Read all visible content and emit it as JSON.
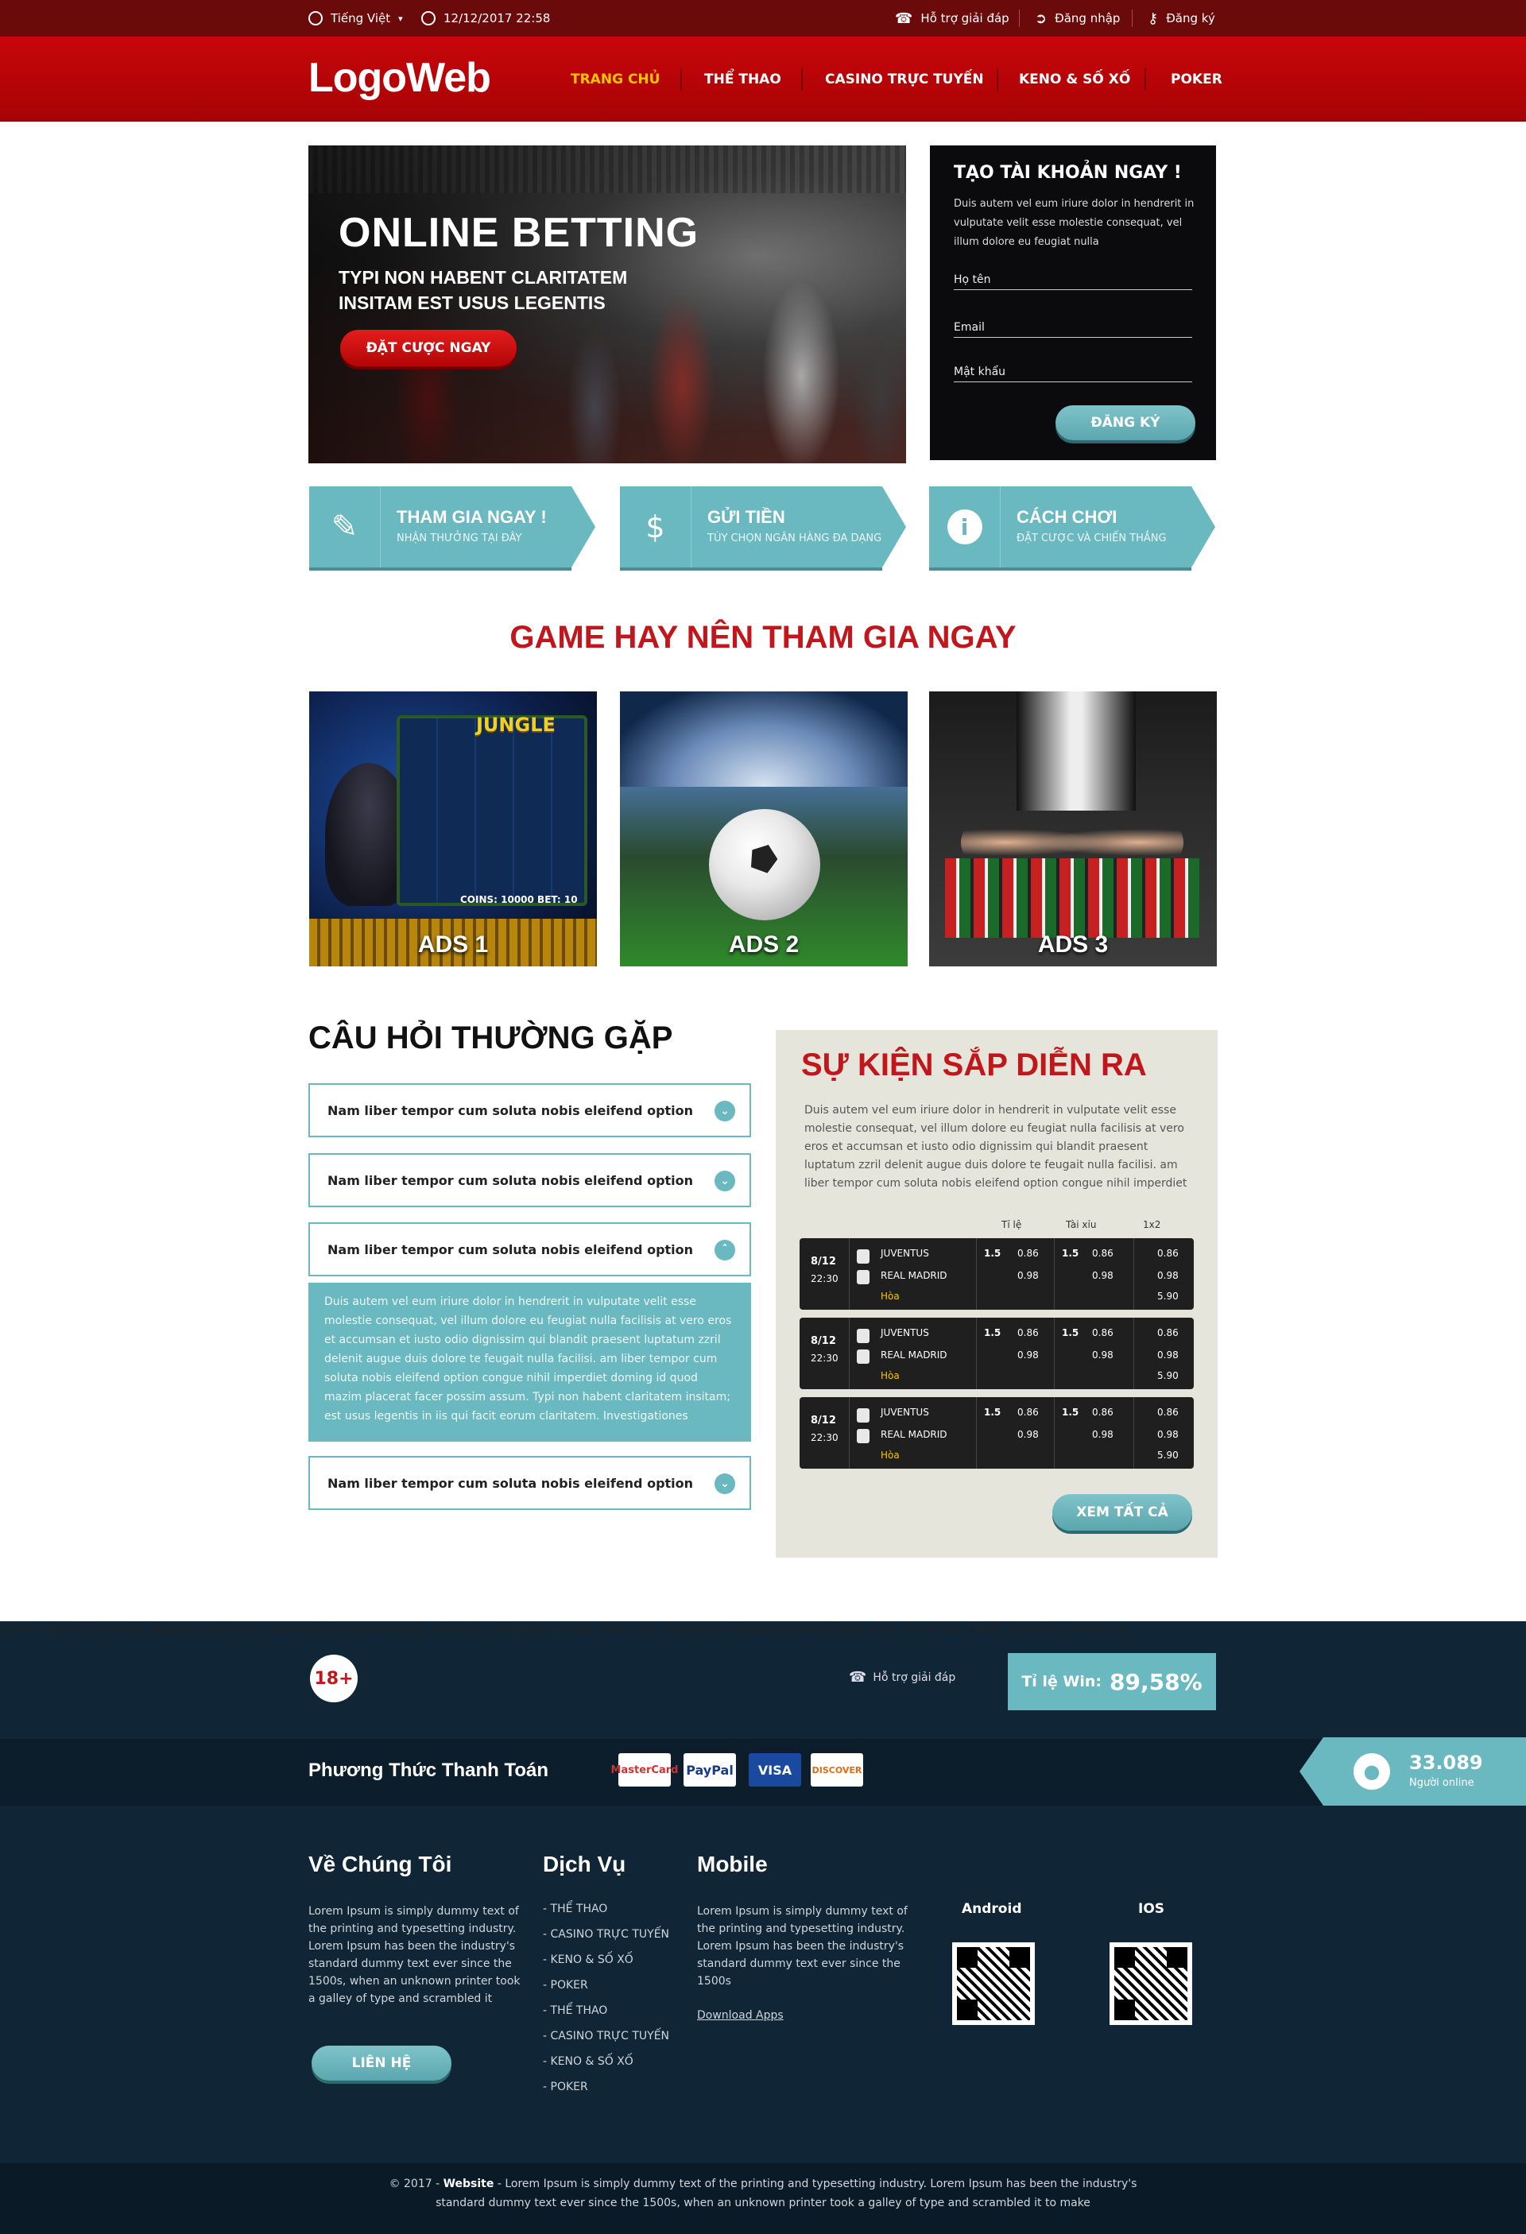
{
  "topbar": {
    "language": "Tiếng Việt",
    "datetime": "12/12/2017 22:58",
    "support": "Hỗ trợ giải đáp",
    "login": "Đăng nhập",
    "register": "Đăng ký"
  },
  "header": {
    "logo": "LogoWeb",
    "nav": [
      "TRANG CHỦ",
      "THỂ THAO",
      "CASINO TRỰC TUYẾN",
      "KENO & SỐ XỐ",
      "POKER"
    ]
  },
  "hero": {
    "title": "ONLINE BETTING",
    "subtitle": "TYPI NON HABENT CLARITATEM INSITAM EST USUS LEGENTIS",
    "cta": "ĐẶT CƯỢC NGAY"
  },
  "signup": {
    "title": "TẠO TÀI KHOẢN NGAY !",
    "desc": "Duis autem vel eum iriure dolor in hendrerit in vulputate velit esse molestie consequat, vel illum dolore eu feugiat nulla",
    "name_label": "Họ tên",
    "email_label": "Email",
    "password_label": "Mật khẩu",
    "submit": "ĐĂNG KÝ"
  },
  "features": [
    {
      "title": "THAM GIA NGAY !",
      "sub": "NHẬN THƯỞNG TẠI ĐÂY"
    },
    {
      "title": "GỬI TIỀN",
      "sub": "TÙY CHỌN NGÂN HÀNG ĐA DẠNG"
    },
    {
      "title": "CÁCH CHƠI",
      "sub": "ĐẶT CƯỢC VÀ CHIẾN THẮNG"
    }
  ],
  "games": {
    "title": "GAME HAY NÊN THAM GIA NGAY",
    "ads": [
      "ADS 1",
      "ADS 2",
      "ADS 3"
    ],
    "jungle": "JUNGLE",
    "coins": "COINS: 10000  BET: 10"
  },
  "faq": {
    "title": "CÂU HỎI THƯỜNG GẶP",
    "question": "Nam liber tempor cum soluta nobis eleifend option",
    "answer": "Duis autem vel eum iriure dolor in hendrerit in vulputate velit esse molestie consequat, vel illum dolore eu feugiat nulla facilisis at vero eros et accumsan et iusto odio dignissim qui blandit praesent luptatum zzril delenit augue duis dolore te feugait nulla facilisi. am liber tempor cum soluta nobis eleifend option congue nihil imperdiet doming id quod mazim placerat facer possim assum. Typi non habent claritatem insitam; est usus legentis in iis qui facit eorum claritatem. Investigationes"
  },
  "events": {
    "title": "SỰ KIỆN SẮP DIỄN RA",
    "desc": "Duis autem vel eum iriure dolor in hendrerit in vulputate velit esse molestie consequat, vel illum dolore eu feugiat nulla facilisis at vero eros et accumsan et iusto odio dignissim qui blandit praesent luptatum zzril delenit augue duis dolore te feugait nulla facilisi. am liber tempor cum soluta nobis eleifend option congue nihil imperdiet",
    "headers": [
      "Tỉ lệ",
      "Tài xỉu",
      "1x2"
    ],
    "match": {
      "date": "8/12",
      "time": "22:30",
      "home": "JUVENTUS",
      "away": "REAL MADRID",
      "draw": "Hòa",
      "hcap": "1.5",
      "ou": "1.5",
      "o1": "0.86",
      "o2": "0.98",
      "o3": "5.90"
    },
    "more": "XEM TẤT CẢ"
  },
  "footer": {
    "age": "18+",
    "age_text": "Lorem Ipsum is simply dummy text of the printing and typesetting industry. Lorem Ipsum has been the industry's standard dummy text ever since the 1500s, when an unknown",
    "support": "Hỗ trợ giải đáp",
    "win_label": "Tỉ lệ Win:",
    "win_value": "89,58%",
    "payment_title": "Phương Thức Thanh Toán",
    "payments": [
      "MasterCard",
      "PayPal",
      "VISA",
      "DISCOVER"
    ],
    "online_count": "33.089",
    "online_label": "Người online",
    "about_title": "Về Chúng Tôi",
    "about_text": "Lorem Ipsum is simply dummy text of the printing and typesetting industry. Lorem Ipsum has been the industry's standard dummy text ever since the 1500s, when an unknown printer took a galley of type and scrambled it",
    "contact": "LIÊN HỆ",
    "service_title": "Dịch Vụ",
    "services": [
      "THỂ THAO",
      "CASINO TRỰC TUYẾN",
      "KENO & SỐ XỐ",
      "POKER",
      "THỂ THAO",
      "CASINO TRỰC TUYẾN",
      "KENO & SỐ XỐ",
      "POKER"
    ],
    "mobile_title": "Mobile",
    "mobile_text": "Lorem Ipsum is simply dummy text of the printing and typesetting industry. Lorem Ipsum has been the industry's standard dummy text ever since the 1500s",
    "download": "Download Apps",
    "android": "Android",
    "ios": "IOS",
    "copyright_prefix": "© 2017 - ",
    "copyright_site": "Website",
    "copyright_text": " - Lorem Ipsum is simply dummy text of the printing and typesetting industry. Lorem Ipsum has been the industry's standard dummy text ever since the 1500s, when an unknown printer took a galley of type and scrambled it to make"
  },
  "colors": {
    "brand_red": "#c1161b",
    "teal": "#6ab8c0",
    "navy": "#102535"
  }
}
